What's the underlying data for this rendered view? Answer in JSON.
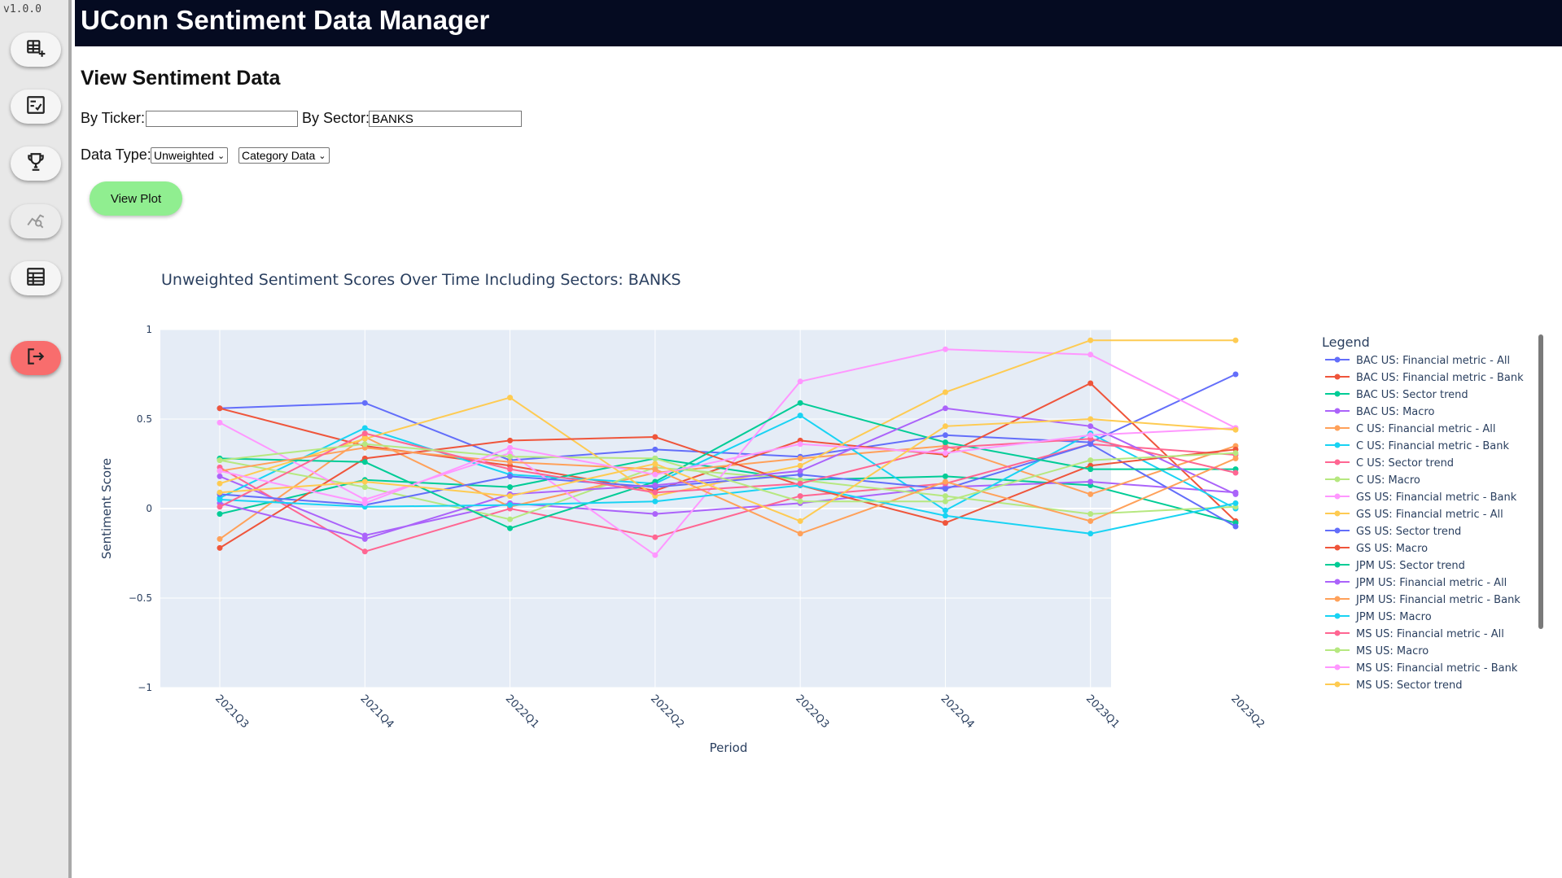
{
  "sidebar": {
    "version": "v1.0.0",
    "items": [
      {
        "icon": "add-table-icon"
      },
      {
        "icon": "checklist-icon"
      },
      {
        "icon": "trophy-icon"
      },
      {
        "icon": "chart-search-icon"
      },
      {
        "icon": "data-sheet-icon"
      },
      {
        "icon": "logout-icon"
      }
    ]
  },
  "header": {
    "title": "UConn Sentiment Data Manager"
  },
  "page": {
    "title": "View Sentiment Data"
  },
  "filters": {
    "ticker_label": "By Ticker:",
    "ticker_value": "",
    "sector_label": "By Sector:",
    "sector_value": "BANKS",
    "data_type_label": "Data Type:",
    "weighting_selected": "Unweighted",
    "category_selected": "Category Data"
  },
  "actions": {
    "view_plot": "View Plot"
  },
  "colors": {
    "header_bg": "#050b21",
    "plot_bg": "#e5ecf6",
    "view_plot_btn": "#90ee90",
    "logout_btn": "#f86d6d"
  },
  "chart_data": {
    "type": "line",
    "title": "Unweighted Sentiment Scores Over Time Including Sectors: BANKS",
    "xlabel": "Period",
    "ylabel": "Sentiment Score",
    "ylim": [
      -1,
      1
    ],
    "yticks": [
      "1",
      "0.5",
      "0",
      "−0.5",
      "−1"
    ],
    "grid": true,
    "legend_title": "Legend",
    "legend_position": "right",
    "categories": [
      "2021Q3",
      "2021Q4",
      "2022Q1",
      "2022Q2",
      "2022Q3",
      "2022Q4",
      "2023Q1",
      "2023Q2"
    ],
    "series": [
      {
        "name": "BAC US: Financial metric - All",
        "color": "#636efa",
        "values": [
          0.56,
          0.59,
          0.27,
          0.33,
          0.29,
          0.41,
          0.37,
          0.75
        ]
      },
      {
        "name": "BAC US: Financial metric - Bank",
        "color": "#ef553b",
        "values": [
          0.56,
          0.35,
          0.24,
          0.1,
          0.38,
          0.3,
          0.7,
          -0.07
        ]
      },
      {
        "name": "BAC US: Sector trend",
        "color": "#00cc96",
        "values": [
          -0.03,
          0.16,
          0.12,
          0.28,
          0.16,
          0.18,
          0.13,
          -0.08
        ]
      },
      {
        "name": "BAC US: Macro",
        "color": "#ab63fa",
        "values": [
          0.18,
          -0.15,
          0.03,
          -0.03,
          0.03,
          0.12,
          0.15,
          0.09
        ]
      },
      {
        "name": "C US: Financial metric - All",
        "color": "#ffa15a",
        "values": [
          -0.17,
          0.4,
          0.01,
          0.2,
          0.28,
          0.35,
          0.08,
          0.35
        ]
      },
      {
        "name": "C US: Financial metric - Bank",
        "color": "#19d3f3",
        "values": [
          0.06,
          0.45,
          0.19,
          0.14,
          0.52,
          -0.01,
          0.42,
          0.0
        ]
      },
      {
        "name": "C US: Sector trend",
        "color": "#ff6692",
        "values": [
          0.23,
          -0.24,
          0.0,
          -0.16,
          0.07,
          0.14,
          0.36,
          0.3
        ]
      },
      {
        "name": "C US: Macro",
        "color": "#b6e880",
        "values": [
          0.27,
          0.12,
          -0.06,
          0.23,
          0.16,
          0.07,
          -0.03,
          0.01
        ]
      },
      {
        "name": "GS US: Financial metric - Bank",
        "color": "#ff97ff",
        "values": [
          0.48,
          0.05,
          0.31,
          -0.26,
          0.71,
          0.89,
          0.86,
          0.45
        ]
      },
      {
        "name": "GS US: Financial metric - All",
        "color": "#fecb52",
        "values": [
          0.14,
          0.39,
          0.62,
          0.07,
          0.24,
          0.65,
          0.94,
          0.94
        ]
      },
      {
        "name": "GS US: Sector trend",
        "color": "#636efa",
        "values": [
          0.08,
          0.02,
          0.18,
          0.12,
          0.19,
          0.11,
          0.36,
          -0.1
        ]
      },
      {
        "name": "GS US: Macro",
        "color": "#ef553b",
        "values": [
          -0.22,
          0.28,
          0.38,
          0.4,
          0.13,
          -0.08,
          0.24,
          0.33
        ]
      },
      {
        "name": "JPM US: Sector trend",
        "color": "#00cc96",
        "values": [
          0.28,
          0.26,
          -0.11,
          0.15,
          0.59,
          0.37,
          0.22,
          0.22
        ]
      },
      {
        "name": "JPM US: Financial metric - All",
        "color": "#ab63fa",
        "values": [
          0.03,
          -0.17,
          0.08,
          0.13,
          0.21,
          0.56,
          0.46,
          0.08
        ]
      },
      {
        "name": "JPM US: Financial metric - Bank",
        "color": "#ffa15a",
        "values": [
          0.21,
          0.34,
          0.26,
          0.22,
          -0.14,
          0.15,
          -0.07,
          0.28
        ]
      },
      {
        "name": "JPM US: Macro",
        "color": "#19d3f3",
        "values": [
          0.05,
          0.01,
          0.02,
          0.04,
          0.13,
          -0.04,
          -0.14,
          0.03
        ]
      },
      {
        "name": "MS US: Financial metric - All",
        "color": "#ff6692",
        "values": [
          0.01,
          0.42,
          0.22,
          0.09,
          0.14,
          0.34,
          0.39,
          0.2
        ]
      },
      {
        "name": "MS US: Macro",
        "color": "#b6e880",
        "values": [
          0.27,
          0.36,
          0.29,
          0.28,
          0.04,
          0.04,
          0.27,
          0.31
        ]
      },
      {
        "name": "MS US: Financial metric - Bank",
        "color": "#ff97ff",
        "values": [
          0.21,
          0.03,
          0.34,
          0.19,
          0.36,
          0.31,
          0.41,
          0.45
        ]
      },
      {
        "name": "MS US: Sector trend",
        "color": "#fecb52",
        "values": [
          0.09,
          0.15,
          0.07,
          0.25,
          -0.07,
          0.46,
          0.5,
          0.44
        ]
      }
    ]
  }
}
